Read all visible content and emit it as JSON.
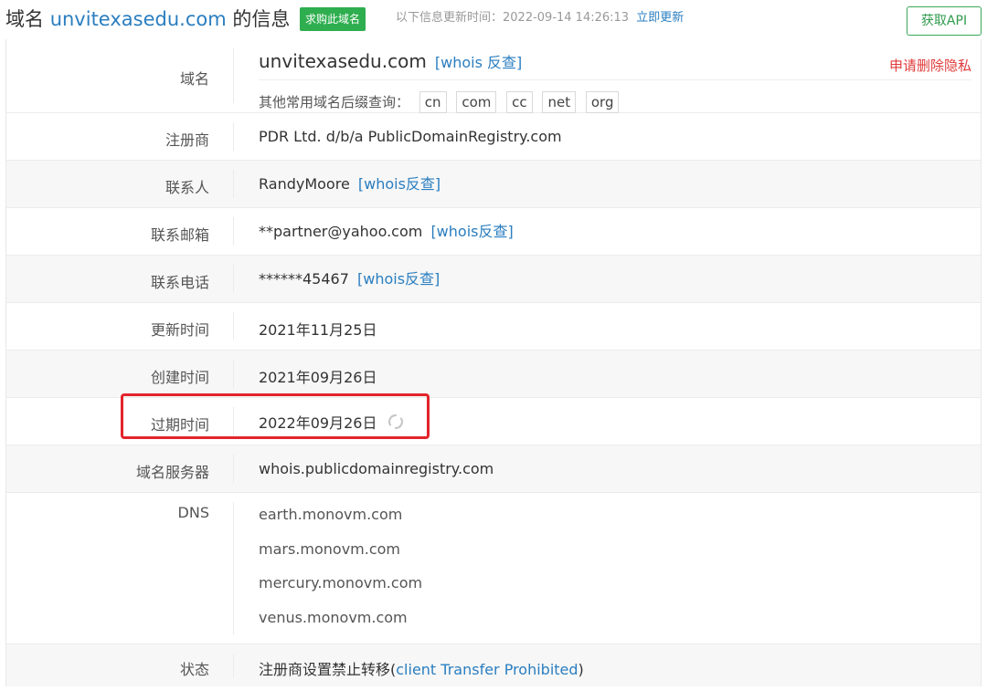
{
  "header": {
    "title_prefix": "域名",
    "domain": "unvitexasedu.com",
    "title_suffix": "的信息",
    "buy_badge": "求购此域名",
    "update_info": "以下信息更新时间：2022-09-14 14:26:13",
    "update_now": "立即更新",
    "api_button": "获取API"
  },
  "rows": {
    "domain": {
      "label": "域名",
      "value": "unvitexasedu.com",
      "whois_link": "[whois 反查]",
      "privacy_link": "申请删除隐私",
      "suffix_label": "其他常用域名后缀查询：",
      "suffixes": [
        "cn",
        "com",
        "cc",
        "net",
        "org"
      ]
    },
    "registrar": {
      "label": "注册商",
      "value": "PDR Ltd. d/b/a PublicDomainRegistry.com"
    },
    "contact": {
      "label": "联系人",
      "value": "RandyMoore",
      "whois_link": "[whois反查]"
    },
    "email": {
      "label": "联系邮箱",
      "value": "**partner@yahoo.com",
      "whois_link": "[whois反查]"
    },
    "phone": {
      "label": "联系电话",
      "value": "******45467",
      "whois_link": "[whois反查]"
    },
    "updated": {
      "label": "更新时间",
      "value": "2021年11月25日"
    },
    "created": {
      "label": "创建时间",
      "value": "2021年09月26日"
    },
    "expires": {
      "label": "过期时间",
      "value": "2022年09月26日"
    },
    "whois_server": {
      "label": "域名服务器",
      "value": "whois.publicdomainregistry.com"
    },
    "dns": {
      "label": "DNS",
      "servers": [
        "earth.monovm.com",
        "mars.monovm.com",
        "mercury.monovm.com",
        "venus.monovm.com"
      ]
    },
    "status": {
      "label": "状态",
      "value_prefix": "注册商设置禁止转移(",
      "value_link": "client Transfer Prohibited",
      "value_suffix": ")"
    }
  },
  "icons": {
    "refresh": "refresh-icon"
  },
  "colors": {
    "link": "#2a7ec0",
    "badge": "#2eae4f",
    "api_border": "#3aa757",
    "privacy": "#e03b3b",
    "highlight": "#e3242b"
  }
}
